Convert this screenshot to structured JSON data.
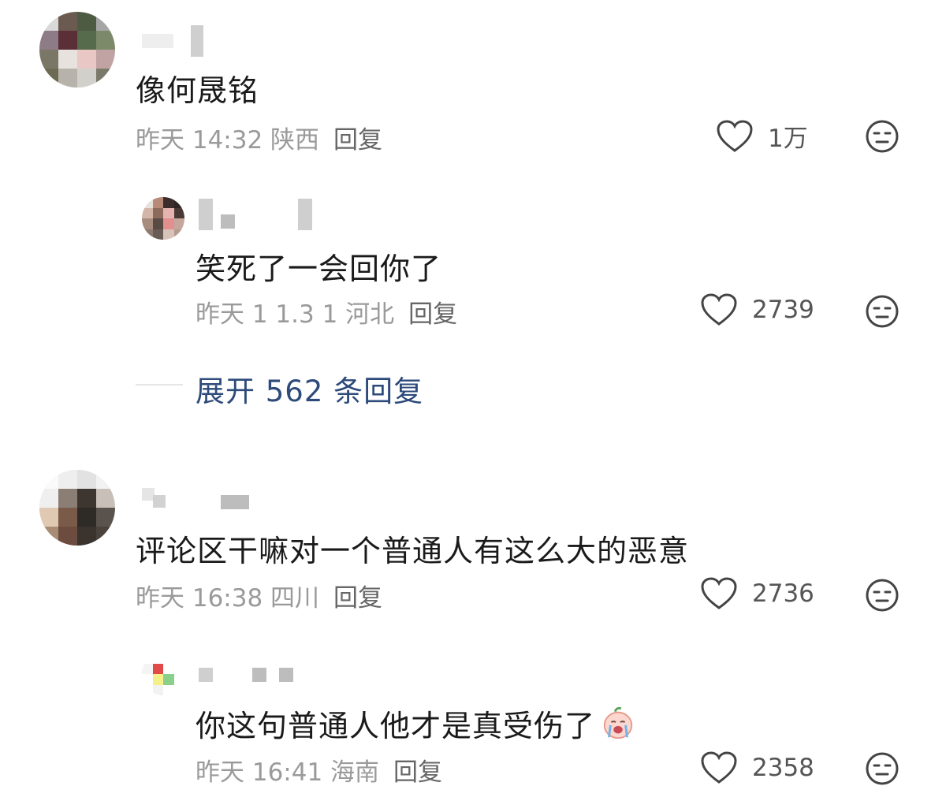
{
  "comments": [
    {
      "text": "像何晟铭",
      "meta": "昨天 14:32 陕西",
      "reply_label": "回复",
      "likes": "1万"
    },
    {
      "text": "笑死了一会回你了",
      "meta": "昨天 1 1.3 1 河北",
      "reply_label": "回复",
      "likes": "2739"
    },
    {
      "text": "评论区干嘛对一个普通人有这么大的恶意",
      "meta": "昨天 16:38 四川",
      "reply_label": "回复",
      "likes": "2736"
    },
    {
      "text": "你这句普通人他才是真受伤了",
      "meta": "昨天 16:41 海南",
      "reply_label": "回复",
      "likes": "2358"
    }
  ],
  "expand_replies": "展开 562 条回复",
  "icons": {
    "like": "heart-outline-icon",
    "dislike": "meh-face-icon",
    "emoji": "crying-peach-emoji"
  },
  "colors": {
    "meta": "#9a9a9a",
    "expand": "#2d4a7a",
    "text": "#1a1a1a"
  }
}
